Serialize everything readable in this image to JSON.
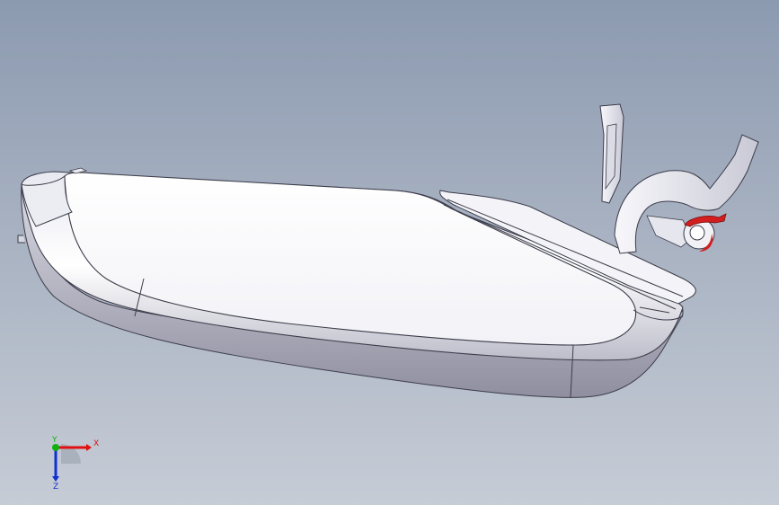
{
  "viewport": {
    "background_top": "#8c9ab0",
    "background_bottom": "#c6ccd6"
  },
  "model": {
    "part": "door-handle-assembly",
    "highlight_color": "#d21e1e"
  },
  "triad": {
    "x_label": "X",
    "y_label": "Y",
    "z_label": "Z",
    "x_color": "#e01010",
    "y_color": "#10b010",
    "z_color": "#1030d0"
  }
}
